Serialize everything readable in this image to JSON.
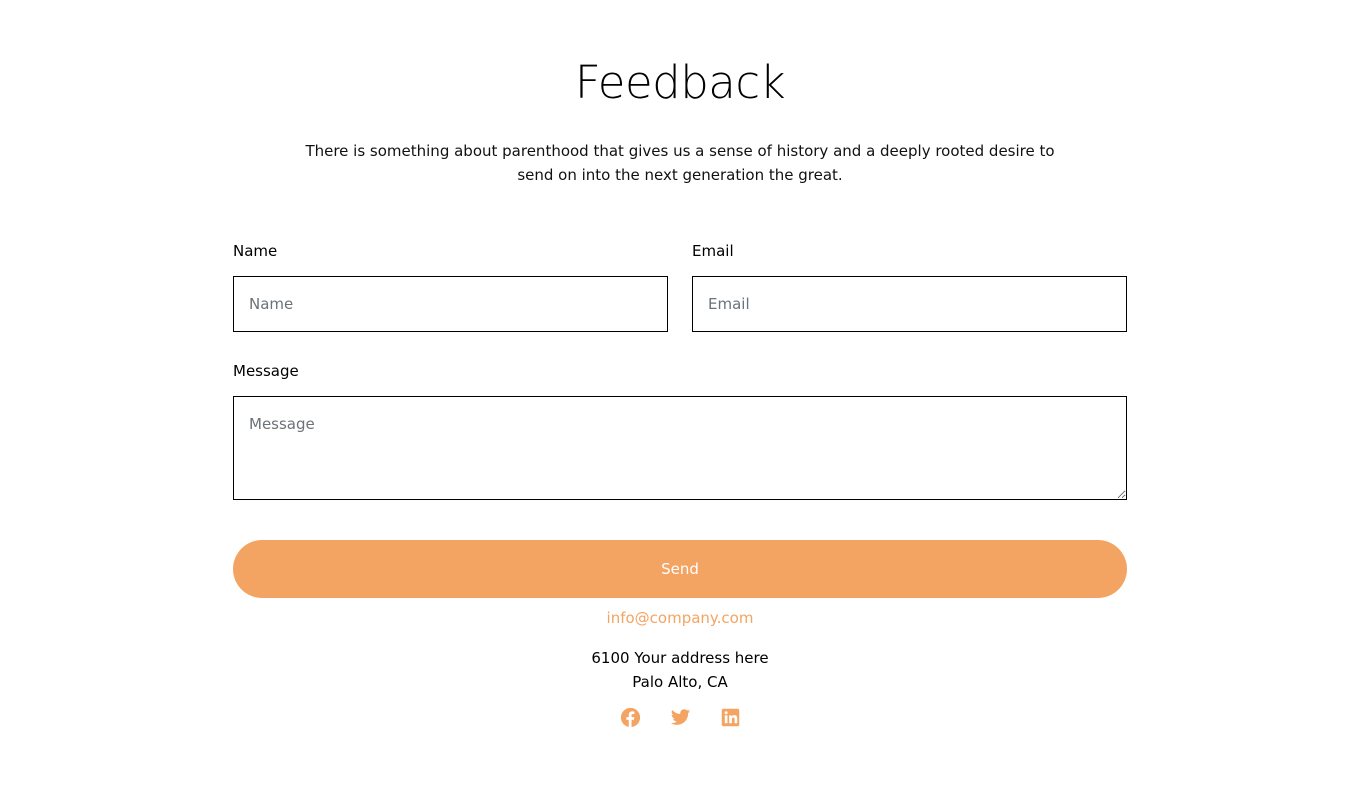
{
  "header": {
    "title": "Feedback",
    "subtitle": "There is something about parenthood that gives us a sense of history and a deeply rooted desire to send on into the next generation the great."
  },
  "form": {
    "name": {
      "label": "Name",
      "placeholder": "Name",
      "value": ""
    },
    "email": {
      "label": "Email",
      "placeholder": "Email",
      "value": ""
    },
    "message": {
      "label": "Message",
      "placeholder": "Message",
      "value": ""
    },
    "submit_label": "Send"
  },
  "contact": {
    "email": "info@company.com",
    "address_line1": "6100 Your address here",
    "address_line2": "Palo Alto, CA"
  },
  "socials": [
    {
      "icon": "facebook-icon"
    },
    {
      "icon": "twitter-icon"
    },
    {
      "icon": "linkedin-icon"
    }
  ],
  "colors": {
    "accent": "#f4a462",
    "border": "#000000",
    "placeholder": "#6b7278"
  }
}
